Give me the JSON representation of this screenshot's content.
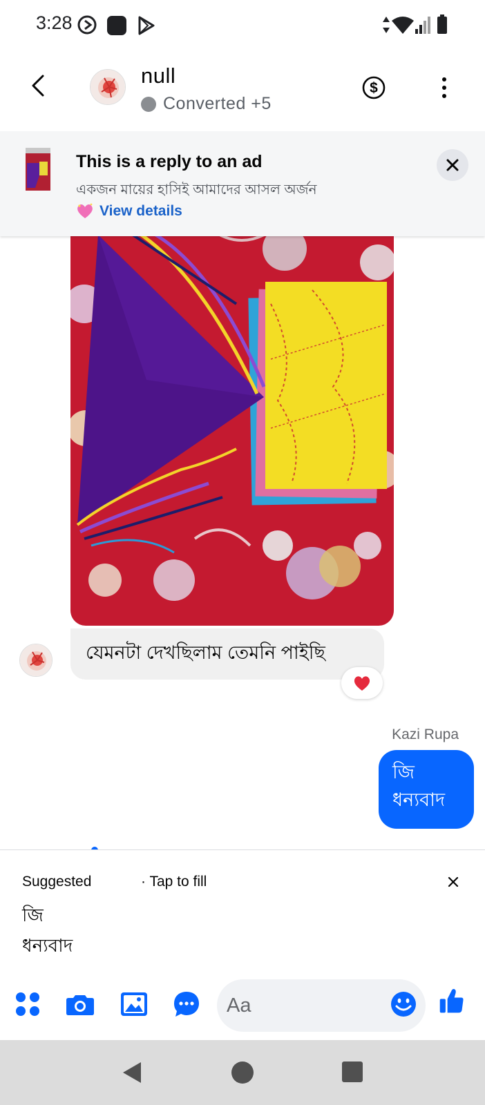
{
  "status_bar": {
    "time": "3:28",
    "icons": [
      "sync-icon",
      "notification-square-icon",
      "play-store-icon",
      "data-arrows-icon",
      "wifi-icon",
      "signal-icon",
      "battery-icon"
    ]
  },
  "header": {
    "contact_name": "null",
    "contact_status": "Converted +5",
    "icons": [
      "back-arrow-icon",
      "dollar-icon",
      "more-vertical-icon"
    ]
  },
  "ad_banner": {
    "title": "This is a reply to an ad",
    "subtitle": "একজন মায়ের হাসিই আমাদের আসল অর্জন",
    "details_link": "View details",
    "details_icon": "sparkling-heart-icon"
  },
  "messages": {
    "received_text": "যেমনটা দেখছিলাম তেমনি পাইছি",
    "reaction": "heart-icon",
    "sent_sender": "Kazi Rupa",
    "sent_text": "জি ধন্যবাদ"
  },
  "suggestions": {
    "header": "Suggested",
    "tap_hint": "· Tap to fill",
    "text": "জি\nধন্যবাদ"
  },
  "composer": {
    "placeholder": "Aa",
    "icons": [
      "apps-grid-icon",
      "camera-icon",
      "gallery-icon",
      "chat-bubble-icon",
      "emoji-icon",
      "thumbs-up-icon"
    ]
  },
  "colors": {
    "accent": "#0866ff",
    "link": "#1a62c9",
    "bubble_received": "#f0f0f0",
    "banner_bg": "#f5f6f7"
  }
}
